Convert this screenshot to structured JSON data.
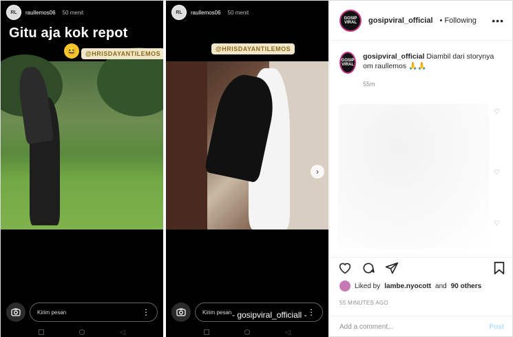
{
  "stories": [
    {
      "username": "raullemos06",
      "time": "50 menit",
      "title": "Gitu aja kok repot",
      "mention": "@HRISDAYANTILEMOS",
      "message_placeholder": "Kirim pesan"
    },
    {
      "username": "raullemos06",
      "time": "50 menit",
      "mention": "@HRISDAYANTILEMOS",
      "message_placeholder": "Kirim pesan",
      "watermark": "- gosipviral_officiall -"
    }
  ],
  "post": {
    "avatar_text": "GOSIP VIRAL",
    "username": "gosipviral_official",
    "follow_status": "• Following",
    "more": "•••",
    "caption_user": "gosipviral_official",
    "caption_text": "Diambil dari storynya om raullemos 🙏🙏",
    "caption_time": "55m",
    "likes_prefix": "Liked by",
    "likes_user": "lambe.nyocott",
    "likes_and": "and",
    "likes_others": "90 others",
    "time_ago": "55 MINUTES AGO",
    "comment_placeholder": "Add a comment...",
    "post_label": "Post"
  },
  "icons": {
    "next": "›",
    "heart": "♡",
    "comment": "○",
    "share": "➤",
    "bookmark": "⛉",
    "camera": "⬤",
    "more_vertical": "⋮"
  }
}
